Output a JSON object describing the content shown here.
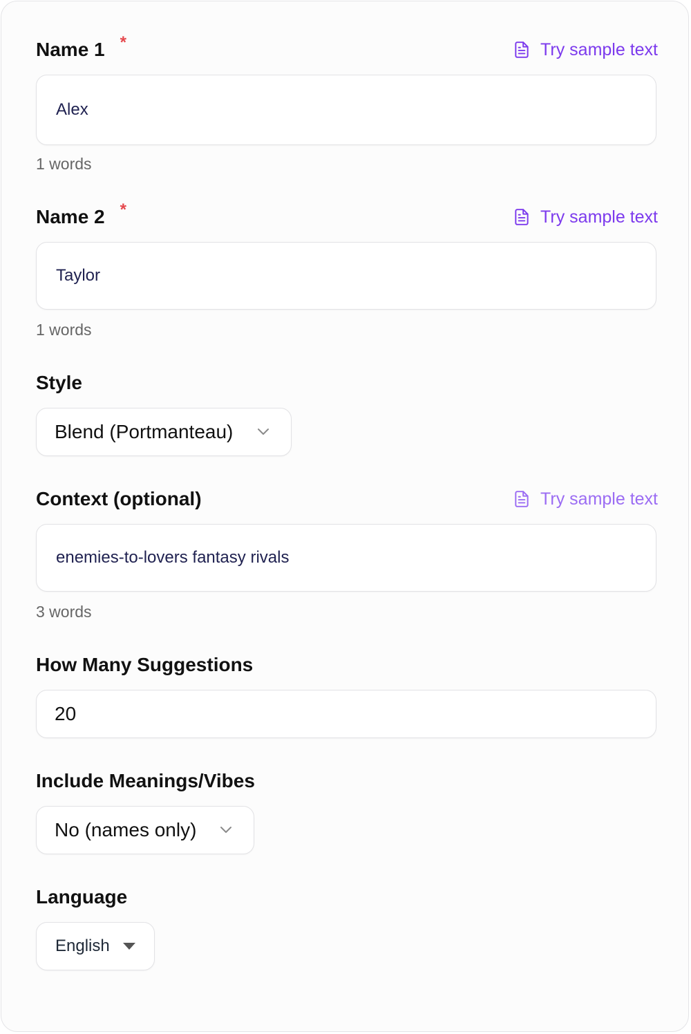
{
  "fields": {
    "name1": {
      "label": "Name 1",
      "required_mark": "*",
      "sample_link": "Try sample text",
      "value": "Alex",
      "word_count": "1 words",
      "sample_icon": "document-icon"
    },
    "name2": {
      "label": "Name 2",
      "required_mark": "*",
      "sample_link": "Try sample text",
      "value": "Taylor",
      "word_count": "1 words",
      "sample_icon": "document-icon"
    },
    "style": {
      "label": "Style",
      "selected": "Blend (Portmanteau)",
      "icon": "chevron-down-icon"
    },
    "context": {
      "label": "Context (optional)",
      "sample_link": "Try sample text",
      "value": "enemies-to-lovers fantasy rivals",
      "word_count": "3 words",
      "sample_icon": "document-icon"
    },
    "suggestions": {
      "label": "How Many Suggestions",
      "value": "20"
    },
    "meanings": {
      "label": "Include Meanings/Vibes",
      "selected": "No (names only)",
      "icon": "chevron-down-icon"
    },
    "language": {
      "label": "Language",
      "selected": "English",
      "icon": "caret-down-icon"
    }
  },
  "colors": {
    "accent": "#7c3aed",
    "required": "#e5484d",
    "input_text": "#1f2150",
    "muted_text": "#666666"
  }
}
